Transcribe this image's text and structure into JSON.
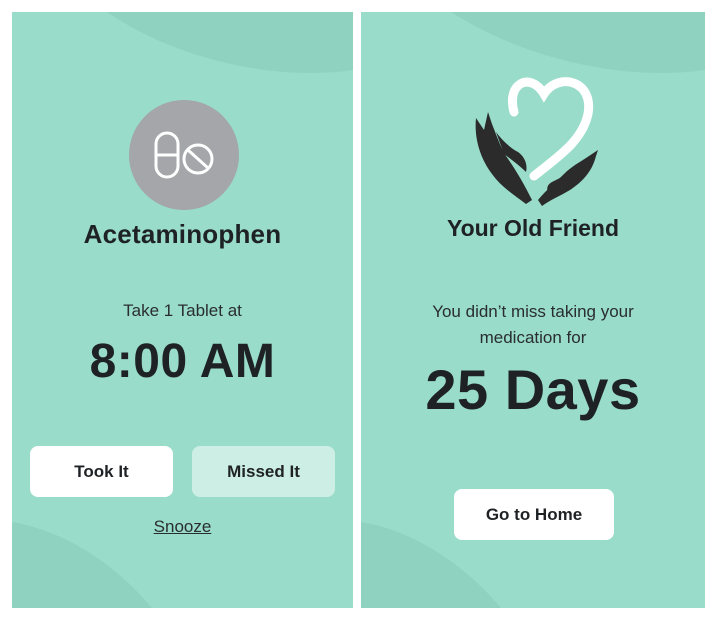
{
  "reminder": {
    "medication_name": "Acetaminophen",
    "instruction": "Take 1 Tablet at",
    "time": "8:00 AM",
    "took_button": "Took It",
    "missed_button": "Missed It",
    "snooze_link": "Snooze",
    "icon": "pills-icon"
  },
  "streak": {
    "brand": "Your Old Friend",
    "message_line1": "You didn’t miss taking your",
    "message_line2": "medication for",
    "days": "25 Days",
    "home_button": "Go to Home",
    "logo_icon": "heart-hands-logo"
  },
  "colors": {
    "background": "#98dcc9",
    "icon_circle": "#a4a6a9",
    "secondary_button": "#cdeee5",
    "text": "#1f2225"
  }
}
